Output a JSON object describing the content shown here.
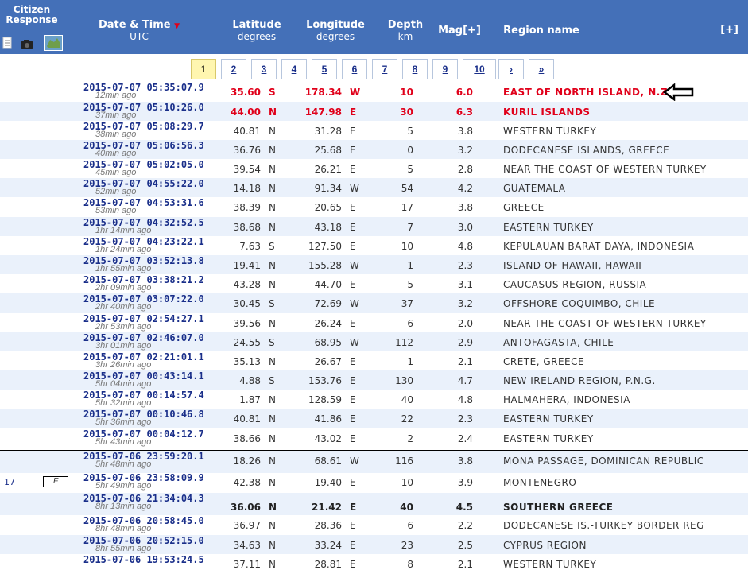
{
  "header": {
    "citizen_line1": "Citizen",
    "citizen_line2": "Response",
    "date_title": "Date & Time",
    "date_sort_icon": "sort-desc-triangle",
    "date_unit": "UTC",
    "lat_title": "Latitude",
    "lat_unit": "degrees",
    "lon_title": "Longitude",
    "lon_unit": "degrees",
    "depth_title": "Depth",
    "depth_unit": "km",
    "mag_title": "Mag[+]",
    "region_title": "Region name",
    "expand_label": "[+]"
  },
  "pagination": {
    "pages": [
      "1",
      "2",
      "3",
      "4",
      "5",
      "6",
      "7",
      "8",
      "9",
      "10"
    ],
    "current": "1",
    "next": "›",
    "last": "»"
  },
  "colors": {
    "header_bg": "#4470b8",
    "alt_row": "#eaf1fb",
    "highlight_red": "#e0001a",
    "date_blue": "#1a2f8a"
  },
  "rows": [
    {
      "dt": "2015-07-07   05:35:07.9",
      "ago": "12min ago",
      "lat": "35.60",
      "latd": "S",
      "lon": "178.34",
      "lond": "W",
      "dep": "10",
      "mag": "6.0",
      "region": "EAST OF NORTH ISLAND, N.Z.",
      "style": "red"
    },
    {
      "dt": "2015-07-07   05:10:26.0",
      "ago": "37min ago",
      "lat": "44.00",
      "latd": "N",
      "lon": "147.98",
      "lond": "E",
      "dep": "30",
      "mag": "6.3",
      "region": "KURIL ISLANDS",
      "style": "red"
    },
    {
      "dt": "2015-07-07   05:08:29.7",
      "ago": "38min ago",
      "lat": "40.81",
      "latd": "N",
      "lon": "31.28",
      "lond": "E",
      "dep": "5",
      "mag": "3.8",
      "region": "WESTERN TURKEY",
      "style": ""
    },
    {
      "dt": "2015-07-07   05:06:56.3",
      "ago": "40min ago",
      "lat": "36.76",
      "latd": "N",
      "lon": "25.68",
      "lond": "E",
      "dep": "0",
      "mag": "3.2",
      "region": "DODECANESE ISLANDS, GREECE",
      "style": ""
    },
    {
      "dt": "2015-07-07   05:02:05.0",
      "ago": "45min ago",
      "lat": "39.54",
      "latd": "N",
      "lon": "26.21",
      "lond": "E",
      "dep": "5",
      "mag": "2.8",
      "region": "NEAR THE COAST OF WESTERN TURKEY",
      "style": ""
    },
    {
      "dt": "2015-07-07   04:55:22.0",
      "ago": "52min ago",
      "lat": "14.18",
      "latd": "N",
      "lon": "91.34",
      "lond": "W",
      "dep": "54",
      "mag": "4.2",
      "region": "GUATEMALA",
      "style": ""
    },
    {
      "dt": "2015-07-07   04:53:31.6",
      "ago": "53min ago",
      "lat": "38.39",
      "latd": "N",
      "lon": "20.65",
      "lond": "E",
      "dep": "17",
      "mag": "3.8",
      "region": "GREECE",
      "style": ""
    },
    {
      "dt": "2015-07-07   04:32:52.5",
      "ago": "1hr 14min ago",
      "lat": "38.68",
      "latd": "N",
      "lon": "43.18",
      "lond": "E",
      "dep": "7",
      "mag": "3.0",
      "region": "EASTERN TURKEY",
      "style": ""
    },
    {
      "dt": "2015-07-07   04:23:22.1",
      "ago": "1hr 24min ago",
      "lat": "7.63",
      "latd": "S",
      "lon": "127.50",
      "lond": "E",
      "dep": "10",
      "mag": "4.8",
      "region": "KEPULAUAN BARAT DAYA, INDONESIA",
      "style": ""
    },
    {
      "dt": "2015-07-07   03:52:13.8",
      "ago": "1hr 55min ago",
      "lat": "19.41",
      "latd": "N",
      "lon": "155.28",
      "lond": "W",
      "dep": "1",
      "mag": "2.3",
      "region": "ISLAND OF HAWAII, HAWAII",
      "style": ""
    },
    {
      "dt": "2015-07-07   03:38:21.2",
      "ago": "2hr 09min ago",
      "lat": "43.28",
      "latd": "N",
      "lon": "44.70",
      "lond": "E",
      "dep": "5",
      "mag": "3.1",
      "region": "CAUCASUS REGION, RUSSIA",
      "style": ""
    },
    {
      "dt": "2015-07-07   03:07:22.0",
      "ago": "2hr 40min ago",
      "lat": "30.45",
      "latd": "S",
      "lon": "72.69",
      "lond": "W",
      "dep": "37",
      "mag": "3.2",
      "region": "OFFSHORE COQUIMBO, CHILE",
      "style": ""
    },
    {
      "dt": "2015-07-07   02:54:27.1",
      "ago": "2hr 53min ago",
      "lat": "39.56",
      "latd": "N",
      "lon": "26.24",
      "lond": "E",
      "dep": "6",
      "mag": "2.0",
      "region": "NEAR THE COAST OF WESTERN TURKEY",
      "style": ""
    },
    {
      "dt": "2015-07-07   02:46:07.0",
      "ago": "3hr 01min ago",
      "lat": "24.55",
      "latd": "S",
      "lon": "68.95",
      "lond": "W",
      "dep": "112",
      "mag": "2.9",
      "region": "ANTOFAGASTA, CHILE",
      "style": ""
    },
    {
      "dt": "2015-07-07   02:21:01.1",
      "ago": "3hr 26min ago",
      "lat": "35.13",
      "latd": "N",
      "lon": "26.67",
      "lond": "E",
      "dep": "1",
      "mag": "2.1",
      "region": "CRETE, GREECE",
      "style": ""
    },
    {
      "dt": "2015-07-07   00:43:14.1",
      "ago": "5hr 04min ago",
      "lat": "4.88",
      "latd": "S",
      "lon": "153.76",
      "lond": "E",
      "dep": "130",
      "mag": "4.7",
      "region": "NEW IRELAND REGION, P.N.G.",
      "style": ""
    },
    {
      "dt": "2015-07-07   00:14:57.4",
      "ago": "5hr 32min ago",
      "lat": "1.87",
      "latd": "N",
      "lon": "128.59",
      "lond": "E",
      "dep": "40",
      "mag": "4.8",
      "region": "HALMAHERA, INDONESIA",
      "style": ""
    },
    {
      "dt": "2015-07-07   00:10:46.8",
      "ago": "5hr 36min ago",
      "lat": "40.81",
      "latd": "N",
      "lon": "41.86",
      "lond": "E",
      "dep": "22",
      "mag": "2.3",
      "region": "EASTERN TURKEY",
      "style": ""
    },
    {
      "dt": "2015-07-07   00:04:12.7",
      "ago": "5hr 43min ago",
      "lat": "38.66",
      "latd": "N",
      "lon": "43.02",
      "lond": "E",
      "dep": "2",
      "mag": "2.4",
      "region": "EASTERN TURKEY",
      "style": ""
    },
    {
      "dt": "2015-07-06   23:59:20.1",
      "ago": "5hr 48min ago",
      "lat": "18.26",
      "latd": "N",
      "lon": "68.61",
      "lond": "W",
      "dep": "116",
      "mag": "3.8",
      "region": "MONA PASSAGE, DOMINICAN REPUBLIC",
      "style": "sep"
    },
    {
      "dt": "2015-07-06   23:58:09.9",
      "ago": "5hr 49min ago",
      "lat": "42.38",
      "latd": "N",
      "lon": "19.40",
      "lond": "E",
      "dep": "10",
      "mag": "3.9",
      "region": "MONTENEGRO",
      "style": "",
      "count": "17",
      "f_label": "F"
    },
    {
      "dt": "2015-07-06   21:34:04.3",
      "ago": "8hr 13min ago",
      "lat": "36.06",
      "latd": "N",
      "lon": "21.42",
      "lond": "E",
      "dep": "40",
      "mag": "4.5",
      "region": "SOUTHERN GREECE",
      "style": "bold"
    },
    {
      "dt": "2015-07-06   20:58:45.0",
      "ago": "8hr 48min ago",
      "lat": "36.97",
      "latd": "N",
      "lon": "28.36",
      "lond": "E",
      "dep": "6",
      "mag": "2.2",
      "region": "DODECANESE IS.-TURKEY BORDER REG",
      "style": ""
    },
    {
      "dt": "2015-07-06   20:52:15.0",
      "ago": "8hr 55min ago",
      "lat": "34.63",
      "latd": "N",
      "lon": "33.24",
      "lond": "E",
      "dep": "23",
      "mag": "2.5",
      "region": "CYPRUS REGION",
      "style": ""
    },
    {
      "dt": "2015-07-06   19:53:24.5",
      "ago": "",
      "lat": "37.11",
      "latd": "N",
      "lon": "28.81",
      "lond": "E",
      "dep": "8",
      "mag": "2.1",
      "region": "WESTERN TURKEY",
      "style": ""
    }
  ]
}
